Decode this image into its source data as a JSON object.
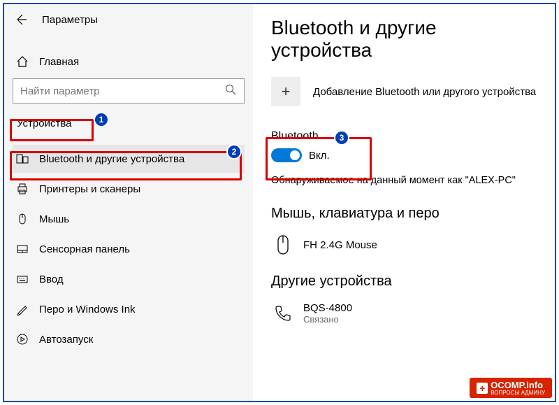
{
  "header": {
    "title": "Параметры"
  },
  "sidebar": {
    "home": "Главная",
    "search_placeholder": "Найти параметр",
    "category": "Устройства",
    "items": [
      {
        "label": "Bluetooth и другие устройства",
        "icon": "bluetooth-devices-icon"
      },
      {
        "label": "Принтеры и сканеры",
        "icon": "printer-icon"
      },
      {
        "label": "Мышь",
        "icon": "mouse-icon"
      },
      {
        "label": "Сенсорная панель",
        "icon": "touchpad-icon"
      },
      {
        "label": "Ввод",
        "icon": "keyboard-icon"
      },
      {
        "label": "Перо и Windows Ink",
        "icon": "pen-icon"
      },
      {
        "label": "Автозапуск",
        "icon": "autoplay-icon"
      }
    ]
  },
  "main": {
    "title": "Bluetooth и другие устройства",
    "add_label": "Добавление Bluetooth или другого устройства",
    "bt_label": "Bluetooth",
    "bt_state": "Вкл.",
    "discoverable": "Обнаруживаемое на данный момент как \"ALEX-PC\"",
    "section1_title": "Мышь, клавиатура и перо",
    "device1_name": "FH 2.4G Mouse",
    "section2_title": "Другие устройства",
    "device2_name": "BQS-4800",
    "device2_status": "Связано"
  },
  "annotations": {
    "n1": "1",
    "n2": "2",
    "n3": "3"
  },
  "watermark": {
    "brand": "OCOMP",
    "tld": ".info",
    "tagline": "ВОПРОСЫ АДМИНУ"
  }
}
